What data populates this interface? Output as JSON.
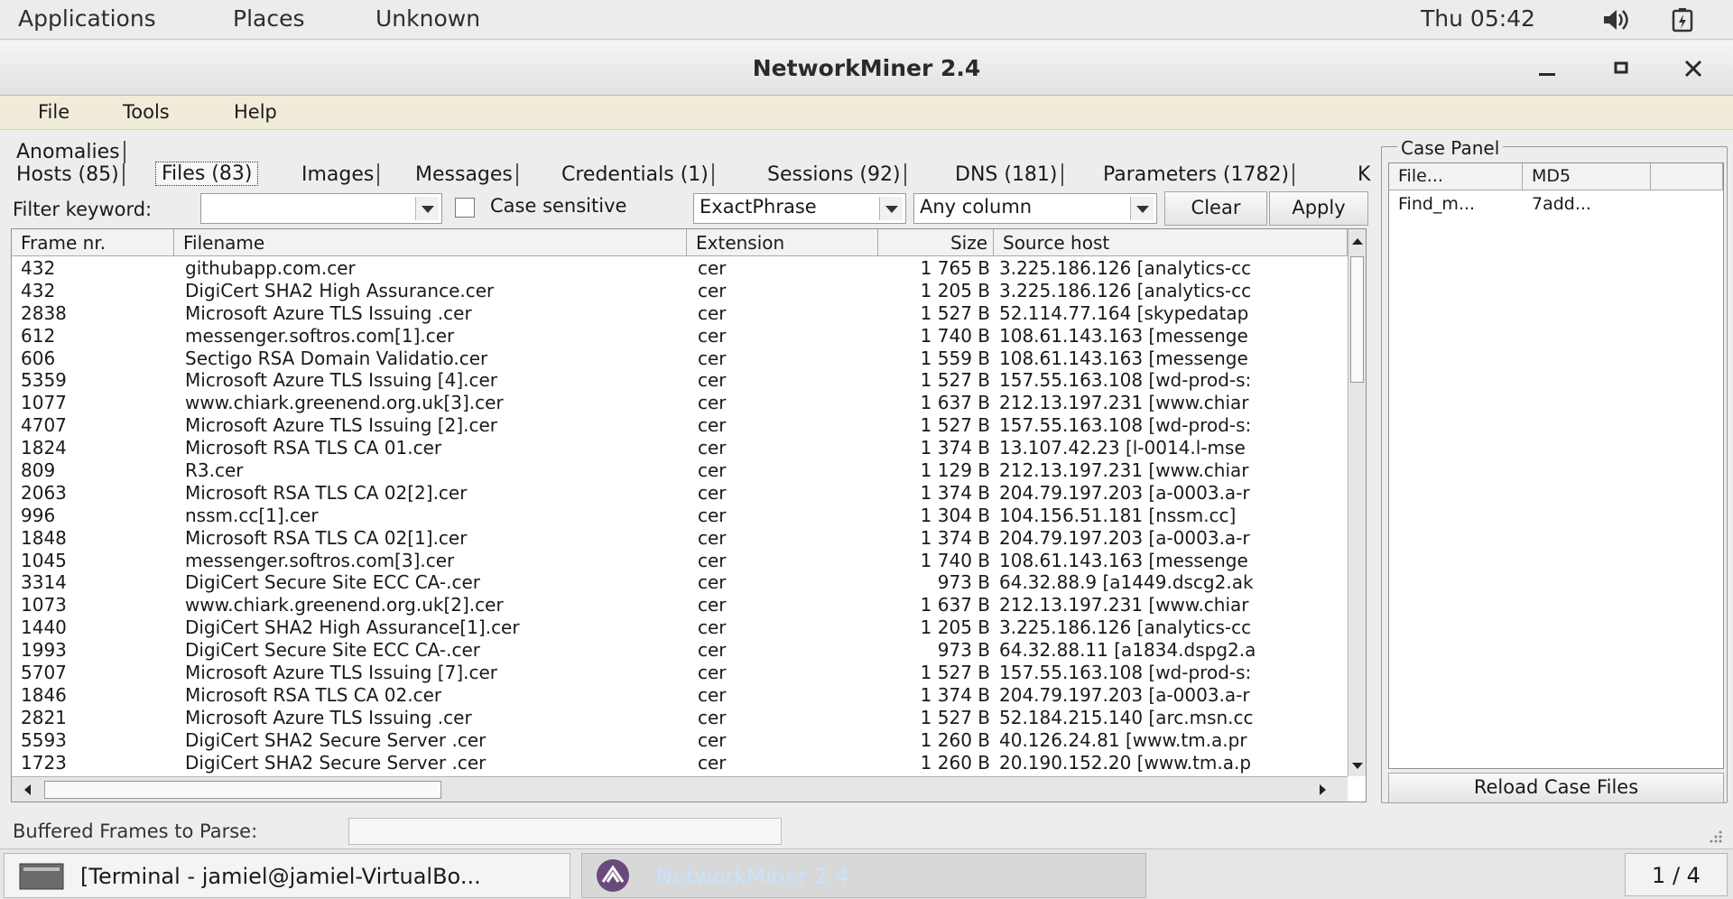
{
  "topbar": {
    "menus": [
      "Applications",
      "Places",
      "Unknown"
    ],
    "clock": "Thu 05:42"
  },
  "window": {
    "title": "NetworkMiner 2.4"
  },
  "menubar": [
    "File",
    "Tools",
    "Help"
  ],
  "tabs": {
    "row1": [
      "Anomalies"
    ],
    "row2": [
      "Hosts (85)",
      "Files (83)",
      "Images",
      "Messages",
      "Credentials (1)",
      "Sessions (92)",
      "DNS (181)",
      "Parameters (1782)",
      "K"
    ],
    "active": "Files (83)"
  },
  "filter": {
    "label": "Filter keyword:",
    "keyword_value": "",
    "case_sensitive_label": "Case sensitive",
    "case_sensitive_checked": false,
    "match_mode": "ExactPhrase",
    "column": "Any column",
    "clear_label": "Clear",
    "apply_label": "Apply"
  },
  "files_table": {
    "columns": [
      "Frame nr.",
      "Filename",
      "Extension",
      "Size",
      "Source host"
    ],
    "rows": [
      [
        "432",
        "githubapp.com.cer",
        "cer",
        "1 765 B",
        "3.225.186.126 [analytics-cc"
      ],
      [
        "432",
        "DigiCert SHA2 High Assurance.cer",
        "cer",
        "1 205 B",
        "3.225.186.126 [analytics-cc"
      ],
      [
        "2838",
        "Microsoft Azure TLS Issuing .cer",
        "cer",
        "1 527 B",
        "52.114.77.164 [skypedatap"
      ],
      [
        "612",
        "messenger.softros.com[1].cer",
        "cer",
        "1 740 B",
        "108.61.143.163 [messenge"
      ],
      [
        "606",
        "Sectigo RSA Domain Validatio.cer",
        "cer",
        "1 559 B",
        "108.61.143.163 [messenge"
      ],
      [
        "5359",
        "Microsoft Azure TLS Issuing [4].cer",
        "cer",
        "1 527 B",
        "157.55.163.108 [wd-prod-s:"
      ],
      [
        "1077",
        "www.chiark.greenend.org.uk[3].cer",
        "cer",
        "1 637 B",
        "212.13.197.231 [www.chiar"
      ],
      [
        "4707",
        "Microsoft Azure TLS Issuing [2].cer",
        "cer",
        "1 527 B",
        "157.55.163.108 [wd-prod-s:"
      ],
      [
        "1824",
        "Microsoft RSA TLS CA 01.cer",
        "cer",
        "1 374 B",
        "13.107.42.23 [l-0014.l-mse"
      ],
      [
        "809",
        "R3.cer",
        "cer",
        "1 129 B",
        "212.13.197.231 [www.chiar"
      ],
      [
        "2063",
        "Microsoft RSA TLS CA 02[2].cer",
        "cer",
        "1 374 B",
        "204.79.197.203 [a-0003.a-r"
      ],
      [
        "996",
        "nssm.cc[1].cer",
        "cer",
        "1 304 B",
        "104.156.51.181 [nssm.cc]"
      ],
      [
        "1848",
        "Microsoft RSA TLS CA 02[1].cer",
        "cer",
        "1 374 B",
        "204.79.197.203 [a-0003.a-r"
      ],
      [
        "1045",
        "messenger.softros.com[3].cer",
        "cer",
        "1 740 B",
        "108.61.143.163 [messenge"
      ],
      [
        "3314",
        "DigiCert Secure Site ECC CA-.cer",
        "cer",
        "973 B",
        "64.32.88.9 [a1449.dscg2.ak"
      ],
      [
        "1073",
        "www.chiark.greenend.org.uk[2].cer",
        "cer",
        "1 637 B",
        "212.13.197.231 [www.chiar"
      ],
      [
        "1440",
        "DigiCert SHA2 High Assurance[1].cer",
        "cer",
        "1 205 B",
        "3.225.186.126 [analytics-cc"
      ],
      [
        "1993",
        "DigiCert Secure Site ECC CA-.cer",
        "cer",
        "973 B",
        "64.32.88.11 [a1834.dspg2.a"
      ],
      [
        "5707",
        "Microsoft Azure TLS Issuing [7].cer",
        "cer",
        "1 527 B",
        "157.55.163.108 [wd-prod-s:"
      ],
      [
        "1846",
        "Microsoft RSA TLS CA 02.cer",
        "cer",
        "1 374 B",
        "204.79.197.203 [a-0003.a-r"
      ],
      [
        "2821",
        "Microsoft Azure TLS Issuing .cer",
        "cer",
        "1 527 B",
        "52.184.215.140 [arc.msn.cc"
      ],
      [
        "5593",
        "DigiCert SHA2 Secure Server .cer",
        "cer",
        "1 260 B",
        "40.126.24.81 [www.tm.a.pr"
      ],
      [
        "1723",
        "DigiCert SHA2 Secure Server .cer",
        "cer",
        "1 260 B",
        "20.190.152.20 [www.tm.a.p"
      ]
    ]
  },
  "case_panel": {
    "title": "Case Panel",
    "columns": [
      "File...",
      "MD5",
      ""
    ],
    "rows": [
      [
        "Find_m...",
        "7add..."
      ]
    ],
    "reload_label": "Reload Case Files"
  },
  "status": {
    "label": "Buffered Frames to Parse:",
    "value": ""
  },
  "taskbar": {
    "tasks": [
      "[Terminal - jamiel@jamiel-VirtualBo...",
      "NetworkMiner 2.4"
    ],
    "pager": "1 / 4"
  }
}
